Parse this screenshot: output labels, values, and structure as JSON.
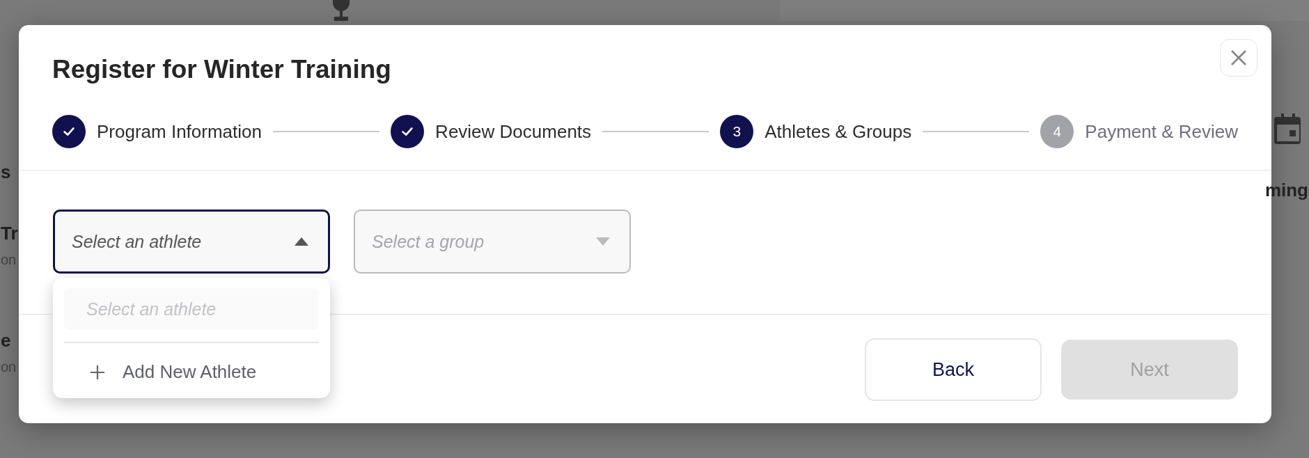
{
  "background": {
    "left_texts": [
      "s",
      "Tr",
      "on",
      "e",
      "on"
    ],
    "right_texts": [
      "ming"
    ]
  },
  "modal": {
    "title": "Register for Winter Training",
    "steps": [
      {
        "label": "Program Information",
        "completed": true
      },
      {
        "label": "Review Documents",
        "completed": true
      },
      {
        "label": "Athletes & Groups",
        "completed": false,
        "active": true,
        "number": "3"
      },
      {
        "label": "Payment & Review",
        "completed": false,
        "active": false,
        "number": "4"
      }
    ],
    "athlete_select": {
      "placeholder": "Select an athlete",
      "expanded": true
    },
    "group_select": {
      "placeholder": "Select a group",
      "disabled": true
    },
    "athlete_dropdown": {
      "search_placeholder": "Select an athlete",
      "items": [
        {
          "label": "Add New Athlete"
        }
      ]
    },
    "buttons": [
      {
        "label": "Back",
        "disabled": false
      },
      {
        "label": "Next",
        "disabled": true
      }
    ]
  }
}
